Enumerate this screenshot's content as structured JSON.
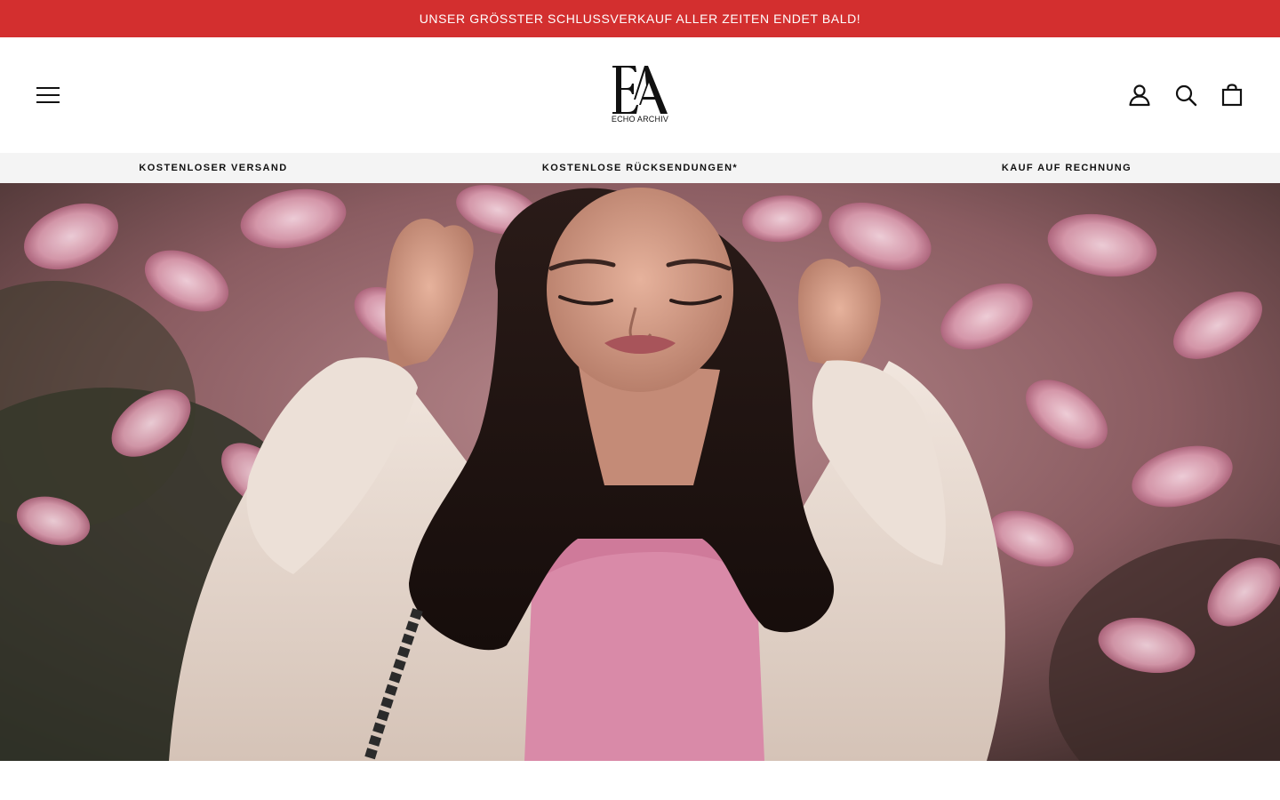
{
  "announcement": {
    "text": "UNSER GRÖSSTER SCHLUSSVERKAUF ALLER ZEITEN ENDET BALD!",
    "background": "#d32f2f",
    "color": "#ffffff"
  },
  "header": {
    "logo": {
      "mark": "EA",
      "text": "ECHO ARCHIV"
    },
    "icons": {
      "menu": "hamburger-menu-icon",
      "account": "user-icon",
      "search": "search-icon",
      "cart": "shopping-bag-icon"
    }
  },
  "usp": {
    "background": "#f4f4f4",
    "items": [
      {
        "label": "KOSTENLOSER VERSAND"
      },
      {
        "label": "KOSTENLOSE RÜCKSENDUNGEN*"
      },
      {
        "label": "KAUF AUF RECHNUNG"
      }
    ]
  },
  "hero": {
    "image": "woman-in-white-coat-magnolia-blossoms"
  }
}
